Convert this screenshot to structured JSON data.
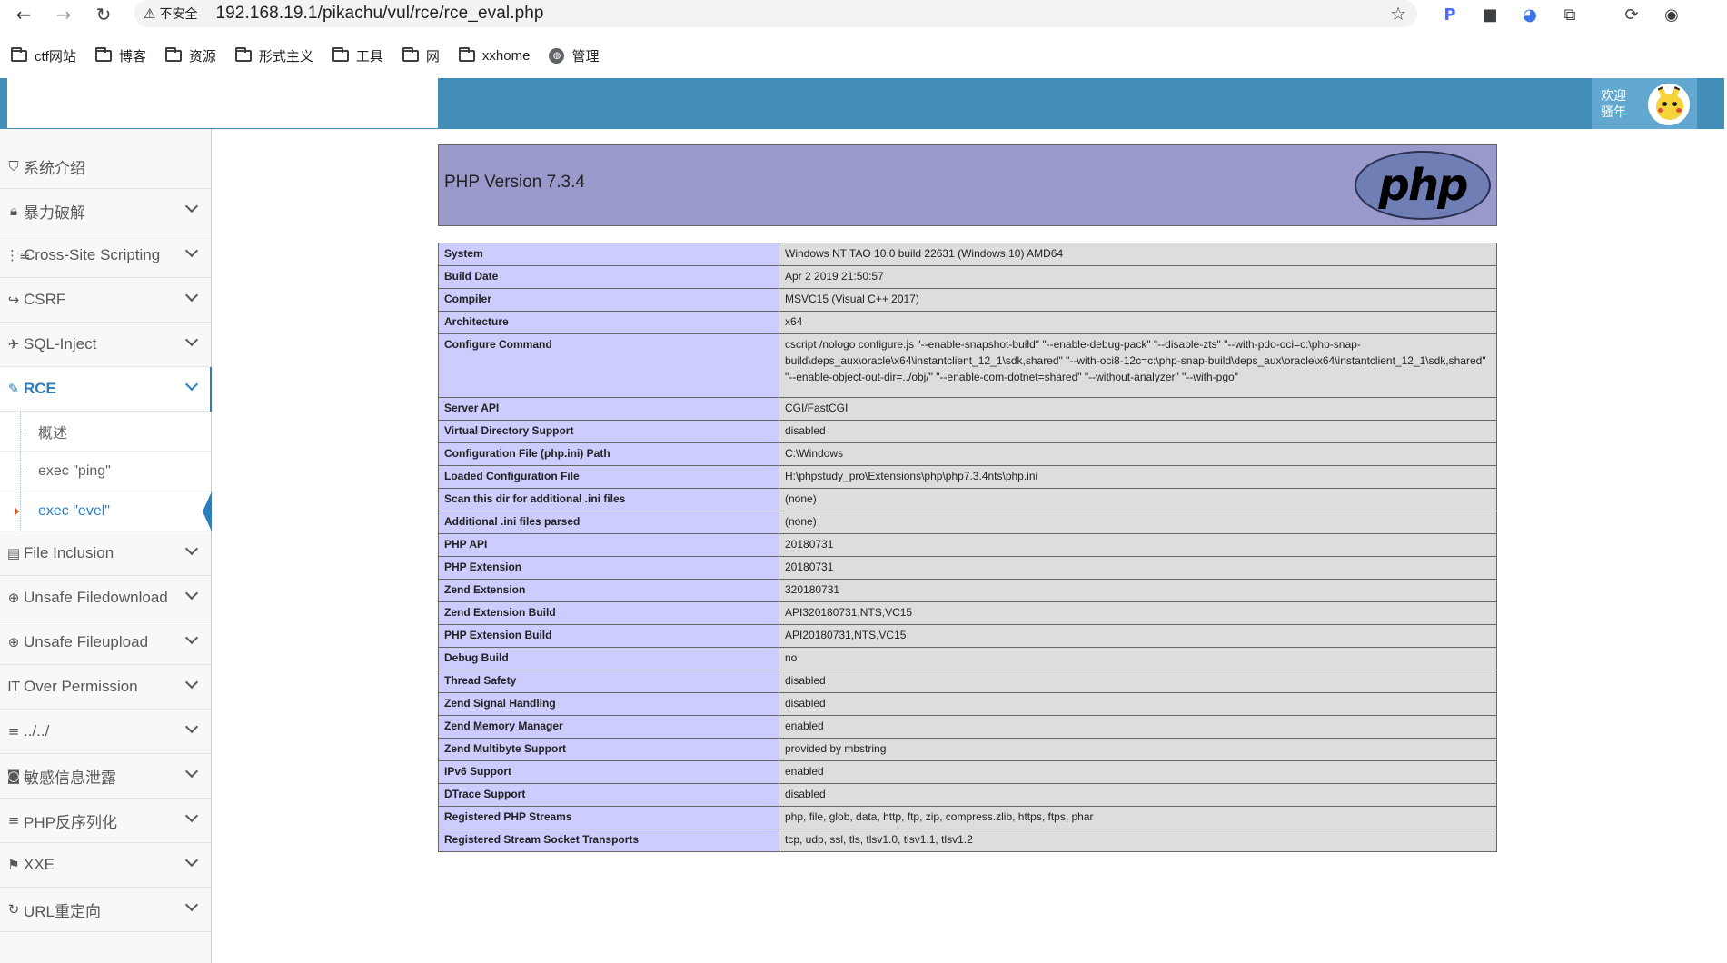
{
  "browser": {
    "security_label": "不安全",
    "url": "192.168.19.1/pikachu/vul/rce/rce_eval.php",
    "bookmarks": [
      "ctf网站",
      "博客",
      "资源",
      "形式主义",
      "工具",
      "网",
      "xxhome",
      "管理"
    ]
  },
  "header": {
    "welcome": "欢迎 骚年"
  },
  "sidebar": {
    "items": [
      {
        "icon": "tags-icon",
        "label": "系统介绍"
      },
      {
        "icon": "lock-icon",
        "label": "暴力破解"
      },
      {
        "icon": "list-icon",
        "label": "Cross-Site Scripting"
      },
      {
        "icon": "share-icon",
        "label": "CSRF"
      },
      {
        "icon": "plane-icon",
        "label": "SQL-Inject"
      },
      {
        "icon": "pencil-icon",
        "label": "RCE"
      },
      {
        "icon": "file-icon",
        "label": "File Inclusion"
      },
      {
        "icon": "download-icon",
        "label": "Unsafe Filedownload"
      },
      {
        "icon": "upload-icon",
        "label": "Unsafe Fileupload"
      },
      {
        "icon": "text-icon",
        "label": "Over Permission"
      },
      {
        "icon": "list-icon",
        "label": "../../"
      },
      {
        "icon": "camera-icon",
        "label": "敏感信息泄露"
      },
      {
        "icon": "list-icon",
        "label": "PHP反序列化"
      },
      {
        "icon": "flag-icon",
        "label": "XXE"
      },
      {
        "icon": "refresh-icon",
        "label": "URL重定向"
      }
    ],
    "rce_sub": [
      "概述",
      "exec \"ping\"",
      "exec \"evel\""
    ]
  },
  "phpinfo": {
    "version": "PHP Version 7.3.4",
    "logo_text": "php",
    "rows": [
      [
        "System",
        "Windows NT TAO 10.0 build 22631 (Windows 10) AMD64"
      ],
      [
        "Build Date",
        "Apr 2 2019 21:50:57"
      ],
      [
        "Compiler",
        "MSVC15 (Visual C++ 2017)"
      ],
      [
        "Architecture",
        "x64"
      ],
      [
        "Configure Command",
        "cscript /nologo configure.js \"--enable-snapshot-build\" \"--enable-debug-pack\" \"--disable-zts\" \"--with-pdo-oci=c:\\php-snap-build\\deps_aux\\oracle\\x64\\instantclient_12_1\\sdk,shared\" \"--with-oci8-12c=c:\\php-snap-build\\deps_aux\\oracle\\x64\\instantclient_12_1\\sdk,shared\" \"--enable-object-out-dir=../obj/\" \"--enable-com-dotnet=shared\" \"--without-analyzer\" \"--with-pgo\""
      ],
      [
        "Server API",
        "CGI/FastCGI"
      ],
      [
        "Virtual Directory Support",
        "disabled"
      ],
      [
        "Configuration File (php.ini) Path",
        "C:\\Windows"
      ],
      [
        "Loaded Configuration File",
        "H:\\phpstudy_pro\\Extensions\\php\\php7.3.4nts\\php.ini"
      ],
      [
        "Scan this dir for additional .ini files",
        "(none)"
      ],
      [
        "Additional .ini files parsed",
        "(none)"
      ],
      [
        "PHP API",
        "20180731"
      ],
      [
        "PHP Extension",
        "20180731"
      ],
      [
        "Zend Extension",
        "320180731"
      ],
      [
        "Zend Extension Build",
        "API320180731,NTS,VC15"
      ],
      [
        "PHP Extension Build",
        "API20180731,NTS,VC15"
      ],
      [
        "Debug Build",
        "no"
      ],
      [
        "Thread Safety",
        "disabled"
      ],
      [
        "Zend Signal Handling",
        "disabled"
      ],
      [
        "Zend Memory Manager",
        "enabled"
      ],
      [
        "Zend Multibyte Support",
        "provided by mbstring"
      ],
      [
        "IPv6 Support",
        "enabled"
      ],
      [
        "DTrace Support",
        "disabled"
      ],
      [
        "Registered PHP Streams",
        "php, file, glob, data, http, ftp, zip, compress.zlib, https, ftps, phar"
      ],
      [
        "Registered Stream Socket Transports",
        "tcp, udp, ssl, tls, tlsv1.0, tlsv1.1, tlsv1.2"
      ]
    ]
  }
}
